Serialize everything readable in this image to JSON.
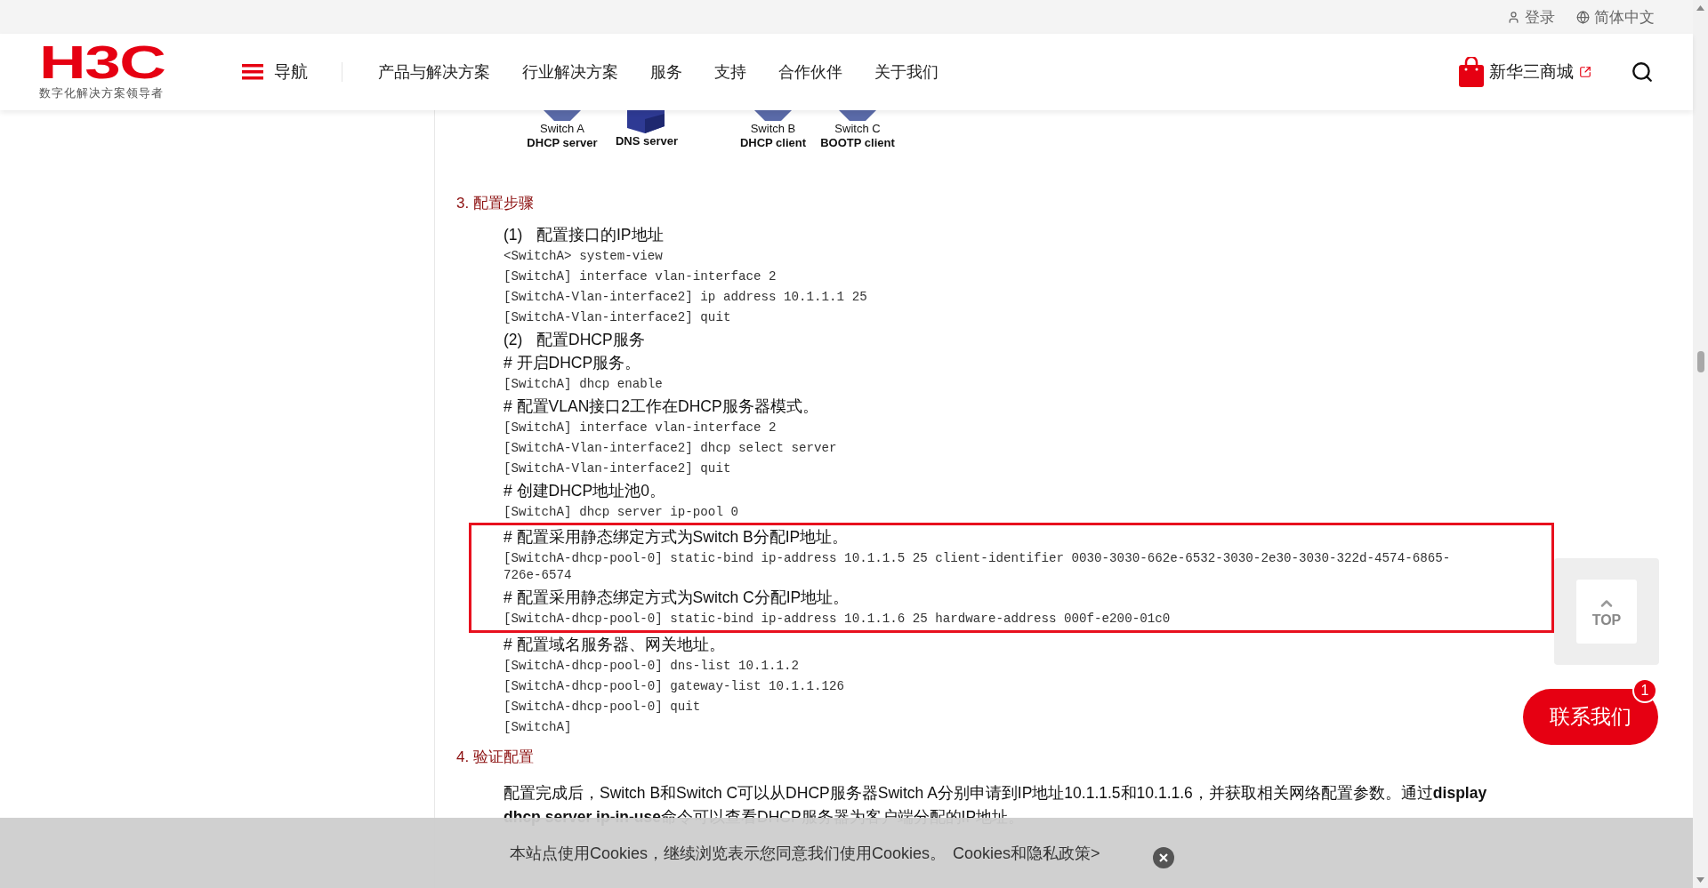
{
  "top_bar": {
    "links": [
      {
        "kind": "login",
        "label": "登录"
      },
      {
        "kind": "language",
        "label": "简体中文"
      }
    ]
  },
  "header": {
    "logo": {
      "mark": "H3C",
      "tagline": "数字化解决方案领导者"
    },
    "nav_toggle": "导航",
    "nav_items": [
      "产品与解决方案",
      "行业解决方案",
      "服务",
      "支持",
      "合作伙伴",
      "关于我们"
    ],
    "shop": "新华三商城"
  },
  "diagram": {
    "nodes": [
      {
        "kind": "switch",
        "name": "Switch A",
        "role": "DHCP server"
      },
      {
        "kind": "server",
        "role": "DNS server"
      },
      {
        "kind": "switch",
        "name": "Switch B",
        "role": "DHCP client"
      },
      {
        "kind": "switch",
        "name": "Switch C",
        "role": "BOOTP client"
      }
    ]
  },
  "sections": [
    {
      "heading": "3. 配置步骤",
      "blocks": [
        {
          "kind": "step",
          "number": "(1)",
          "text": "配置接口的IP地址"
        },
        {
          "kind": "code",
          "text": "<SwitchA> system-view"
        },
        {
          "kind": "code",
          "text": "[SwitchA] interface vlan-interface 2"
        },
        {
          "kind": "code",
          "text": "[SwitchA-Vlan-interface2] ip address 10.1.1.1 25"
        },
        {
          "kind": "code",
          "text": "[SwitchA-Vlan-interface2] quit"
        },
        {
          "kind": "step",
          "number": "(2)",
          "text": "配置DHCP服务"
        },
        {
          "kind": "comment",
          "text": "# 开启DHCP服务。"
        },
        {
          "kind": "code",
          "text": "[SwitchA] dhcp enable"
        },
        {
          "kind": "comment",
          "text": "# 配置VLAN接口2工作在DHCP服务器模式。"
        },
        {
          "kind": "code",
          "text": "[SwitchA] interface vlan-interface 2"
        },
        {
          "kind": "code",
          "text": "[SwitchA-Vlan-interface2] dhcp select server"
        },
        {
          "kind": "code",
          "text": "[SwitchA-Vlan-interface2] quit"
        },
        {
          "kind": "comment",
          "text": "# 创建DHCP地址池0。"
        },
        {
          "kind": "code",
          "text": "[SwitchA] dhcp server ip-pool 0"
        },
        {
          "kind": "highlight",
          "children": [
            {
              "kind": "comment",
              "text": "# 配置采用静态绑定方式为Switch B分配IP地址。"
            },
            {
              "kind": "code",
              "text": "[SwitchA-dhcp-pool-0] static-bind ip-address 10.1.1.5 25 client-identifier 0030-3030-662e-6532-3030-2e30-3030-322d-4574-6865-726e-6574"
            },
            {
              "kind": "comment",
              "text": "# 配置采用静态绑定方式为Switch C分配IP地址。"
            },
            {
              "kind": "code",
              "text": "[SwitchA-dhcp-pool-0] static-bind ip-address 10.1.1.6 25 hardware-address 000f-e200-01c0"
            }
          ]
        },
        {
          "kind": "comment",
          "text": "# 配置域名服务器、网关地址。"
        },
        {
          "kind": "code",
          "text": "[SwitchA-dhcp-pool-0] dns-list 10.1.1.2"
        },
        {
          "kind": "code",
          "text": "[SwitchA-dhcp-pool-0] gateway-list 10.1.1.126"
        },
        {
          "kind": "code",
          "text": "[SwitchA-dhcp-pool-0] quit"
        },
        {
          "kind": "code",
          "text": "[SwitchA]"
        }
      ]
    },
    {
      "heading": "4. 验证配置",
      "blocks": [
        {
          "kind": "paragraph",
          "text": "配置完成后，Switch B和Switch C可以从DHCP服务器Switch A分别申请到IP地址10.1.1.5和10.1.1.6，并获取相关网络配置参数。通过**display dhcp server ip-in-use**命令可以查看DHCP服务器为客户端分配的IP地址。"
        }
      ]
    }
  ],
  "cookie_notice": {
    "text": "本站点使用Cookies，继续浏览表示您同意我们使用Cookies。",
    "link": "Cookies和隐私政策>"
  },
  "back_to_top": "TOP",
  "contact": {
    "label": "联系我们",
    "badge": "1"
  }
}
